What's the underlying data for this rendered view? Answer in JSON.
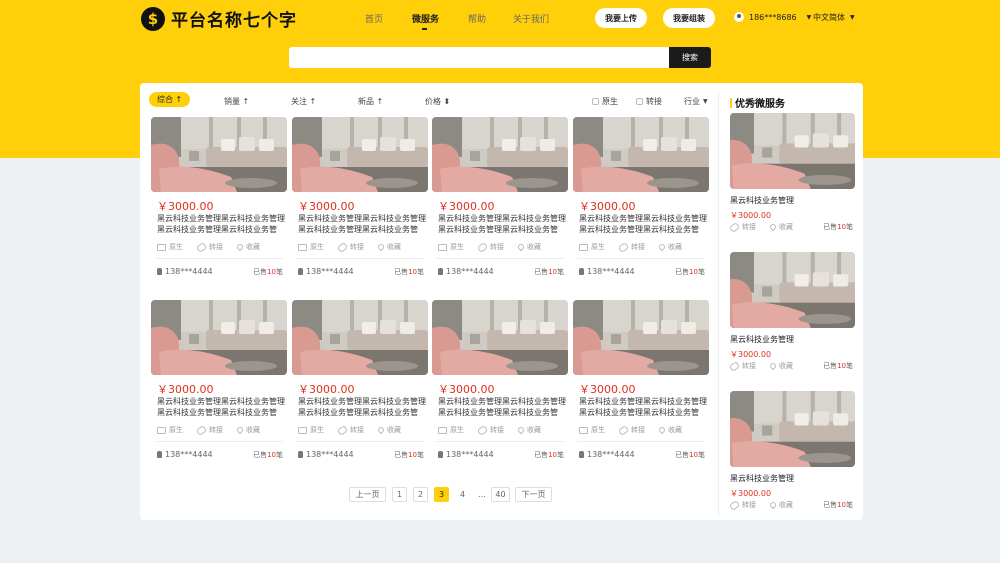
{
  "brand": {
    "name": "平台名称七个字",
    "logo_glyph": "$"
  },
  "nav": [
    {
      "label": "首页"
    },
    {
      "label": "微服务"
    },
    {
      "label": "帮助"
    },
    {
      "label": "关于我们"
    }
  ],
  "header": {
    "upload_label": "我要上传",
    "rent_label": "我要组装",
    "user_phone": "186***8686",
    "language": "中文简体"
  },
  "search": {
    "placeholder": "",
    "button_label": "搜索"
  },
  "filters": {
    "sorts": [
      {
        "label": "综合 ↑"
      },
      {
        "label": "销量 ↑"
      },
      {
        "label": "关注 ↑"
      },
      {
        "label": "新品 ↑"
      },
      {
        "label": "价格 ⬍"
      }
    ],
    "checkbox_original": "原生",
    "checkbox_transfer": "转接",
    "industry": "行业"
  },
  "product": {
    "price": "￥3000.00",
    "desc": "黑云科技业务管理黑云科技业务管理黑云科技业务管理黑云科技业务管",
    "action_original": "原生",
    "action_transfer": "转接",
    "action_favorite": "收藏",
    "seller": "138***4444",
    "sold_prefix": "已售",
    "sold_count": "10",
    "sold_suffix": "笔"
  },
  "pagination": {
    "prev": "上一页",
    "pages": [
      "1",
      "2",
      "3",
      "4"
    ],
    "ellipsis": "…",
    "last": "40",
    "next": "下一页",
    "current": "3"
  },
  "sidebar": {
    "title": "优秀微服务",
    "item_title": "黑云科技业务管理",
    "item_price": "￥3000.00",
    "action_transfer": "转接",
    "action_favorite": "收藏",
    "sold_prefix": "已售",
    "sold_count": "10",
    "sold_suffix": "笔"
  },
  "colors": {
    "brand_yellow": "#ffd00a",
    "price_red": "#e0301e",
    "dark": "#1b1b1b"
  }
}
